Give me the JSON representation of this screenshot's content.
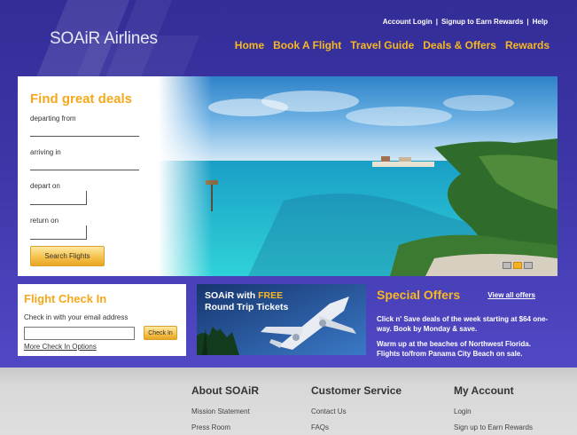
{
  "brand": {
    "logo_text": "SOAiR Airlines"
  },
  "top_links": {
    "login": "Account Login",
    "sep1": "|",
    "signup": "Signup to Earn Rewards",
    "sep2": "|",
    "help": "Help"
  },
  "nav": [
    {
      "label": "Home"
    },
    {
      "label": "Book A Flight"
    },
    {
      "label": "Travel Guide"
    },
    {
      "label": "Deals & Offers"
    },
    {
      "label": "Rewards"
    }
  ],
  "deals": {
    "title": "Find great deals",
    "departing_label": "departing from",
    "arriving_label": "arriving in",
    "depart_on_label": "depart on",
    "return_on_label": "return on",
    "search_button": "Search Flights"
  },
  "carousel": {
    "slides": 3,
    "active_index": 1
  },
  "checkin": {
    "title": "Flight Check In",
    "prompt": "Check in with your email address",
    "button": "Check In",
    "more_link": "More Check In Options"
  },
  "promo": {
    "line1_a": "SOAiR with ",
    "line1_b": "FREE",
    "line2": "Round Trip Tickets"
  },
  "offers": {
    "title": "Special Offers",
    "view_all": "View all offers",
    "text1": "Click n' Save deals of the week starting at $64 one-way. Book by Monday & save.",
    "text2": "Warm up at the beaches of Northwest Florida. Flights to/from Panama City Beach on sale."
  },
  "footer": {
    "about": {
      "title": "About SOAiR",
      "links": [
        "Mission Statement",
        "Press Room"
      ]
    },
    "service": {
      "title": "Customer Service",
      "links": [
        "Contact Us",
        "FAQs"
      ]
    },
    "account": {
      "title": "My Account",
      "links": [
        "Login",
        "Sign up to Earn Rewards"
      ]
    }
  },
  "colors": {
    "accent": "#f6a81c",
    "background": "#3d36a8",
    "footer": "#d8d8d8"
  }
}
